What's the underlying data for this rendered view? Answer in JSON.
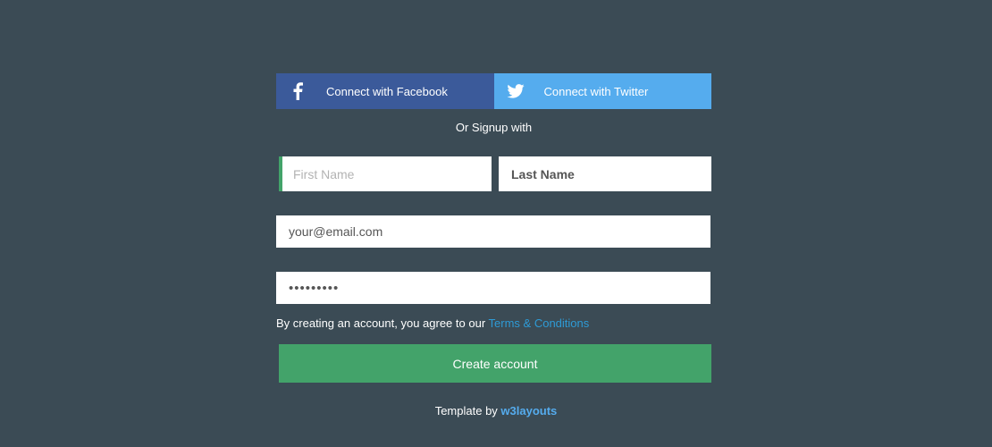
{
  "social": {
    "facebook_label": "Connect with Facebook",
    "facebook_icon": "facebook-icon",
    "twitter_label": "Connect with Twitter",
    "twitter_icon": "twitter-icon"
  },
  "divider_text": "Or Signup with",
  "form": {
    "first_name_placeholder": "First Name",
    "last_name_placeholder": "Last Name",
    "email_value": "your@email.com",
    "password_value": "•••••••••"
  },
  "terms": {
    "text": "By creating an account, you agree to our",
    "link_label": "Terms & Conditions"
  },
  "create_button_label": "Create account",
  "footer": {
    "text": "Template by",
    "link_label": "w3layouts"
  },
  "colors": {
    "background": "#3b4b55",
    "facebook": "#3b5a9a",
    "twitter": "#55acee",
    "accent_green": "#43a36a",
    "link_blue": "#2e9bd6"
  }
}
